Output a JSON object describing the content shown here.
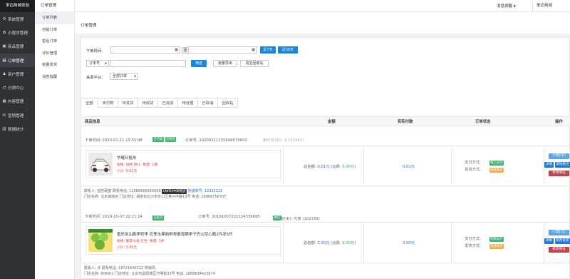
{
  "app": {
    "brand": "来迈商城体验"
  },
  "sidebar": {
    "items": [
      {
        "label": "系统管理",
        "icon": "gear-icon"
      },
      {
        "label": "小程序管理",
        "icon": "miniapp-icon"
      },
      {
        "label": "商品管理",
        "icon": "box-icon"
      },
      {
        "label": "订单管理",
        "icon": "document-icon"
      },
      {
        "label": "用户管理",
        "icon": "user-icon"
      },
      {
        "label": "分销中心",
        "icon": "share-icon"
      },
      {
        "label": "内容管理",
        "icon": "content-icon"
      },
      {
        "label": "营销管理",
        "icon": "gift-icon"
      },
      {
        "label": "数据统计",
        "icon": "chart-icon"
      }
    ]
  },
  "submenu": {
    "title": "订单管理",
    "items": [
      "订单列表",
      "自提订单",
      "售后订单",
      "评价管理",
      "批量发货",
      "消息提醒"
    ]
  },
  "topbar": {
    "notice": "消息提醒",
    "user": "来迈商城"
  },
  "breadcrumb": "订单管理",
  "filters": {
    "time_label": "下单时间:",
    "to": "至",
    "last7": "近7天",
    "last30": "近30天",
    "order_type": "订单号",
    "filter_btn": "筛选",
    "export_btn": "批量导出",
    "recycle_btn": "清空回收站",
    "source_label": "来源平台:",
    "source_value": "全部订单"
  },
  "tabs": [
    "全部",
    "未付款",
    "待发货",
    "待收货",
    "已完成",
    "待处理",
    "已取消",
    "回收站"
  ],
  "table": {
    "headers": {
      "product": "商品信息",
      "amount": "金额",
      "paid": "实际付款",
      "status": "订单状态",
      "action": "操作"
    }
  },
  "orders": [
    {
      "time": "下单时间: 2020-01-11 15:55:48",
      "badges": [
        {
          "text": "已付款",
          "color": "#3cb371"
        },
        {
          "text": "已收货",
          "color": "#3cb371"
        }
      ],
      "order_no": "订单号: 20200111155848676600",
      "user": "用户ID(ID): 1(101981)",
      "product": {
        "name": "华耀日租车",
        "attr": "规格: 规格 默认",
        "qty": "数量: 1辆",
        "subtotal": "小计: 0.01元"
      },
      "amount": "总金额: ",
      "amount_val": "0.01元",
      "freight": "(运费: ",
      "freight_val": "0.00元",
      "freight_end": ")",
      "paid": "0.01元",
      "pay_method": "支付方式:",
      "pay_badge": "线上支付",
      "ship_method": "发货方式:",
      "ship_badge": "快递发货",
      "contact": "联系人: 监控硬盘     联系电话: 12586666655666",
      "express_tag": "CNPEX中邮物流",
      "express_no": "快递单号: 12323123",
      "address": "门店名称: 北京城南店     门店地址: 湖南省长沙市天心区黄兴中路13号     电话: 18968758707",
      "actions": [
        {
          "text": "小票打印",
          "color": "#5aa5e6"
        },
        {
          "text": "详情",
          "color": "#1f7ad6"
        },
        {
          "text": "添加备注",
          "color": "#1f7ad6"
        },
        {
          "text": "修改地址",
          "color": "#c2414a"
        }
      ]
    },
    {
      "time": "下单时间: 2019-10-07 22:21:24",
      "badges": [
        {
          "text": "有退款",
          "color": "#d9534f"
        },
        {
          "text": "已付款",
          "color": "#3cb371"
        },
        {
          "text": "已发货",
          "color": "#3cb371"
        }
      ],
      "order_no": "订单号: 20191007222124339695",
      "user": "用户名(ID): 光泉 (102339)",
      "user_badge": "微信",
      "product": {
        "name": "重庆巫山脆李奶李 应季水果新鲜青脆现摘李子巴山空心脆2件发5斤",
        "attr": "规格: 脆李分类 红色",
        "qty": "数量: 1件",
        "subtotal": "小计: 3.00元"
      },
      "amount": "总金额: ",
      "amount_val": "3.00元",
      "freight": "(运费: ",
      "freight_val": "0.00元",
      "freight_end": ")",
      "paid": "3.00元",
      "pay_method": "支付方式:",
      "pay_badge": "余额支付",
      "ship_method": "发货方式:",
      "ship_badge": "快递发货",
      "contact": "联系人: 沈     联系电话: 18721640112     核销员:",
      "address": "门店名称: 好好好1     门店地址: 北京市昌阳楼区竹明街33号     电话: 1868634423674",
      "actions": [
        {
          "text": "小票打印",
          "color": "#5aa5e6"
        },
        {
          "text": "详情",
          "color": "#1f7ad6"
        },
        {
          "text": "修改发货",
          "color": "#1f7ad6"
        },
        {
          "text": "修改地址",
          "color": "#c2414a"
        }
      ]
    }
  ]
}
